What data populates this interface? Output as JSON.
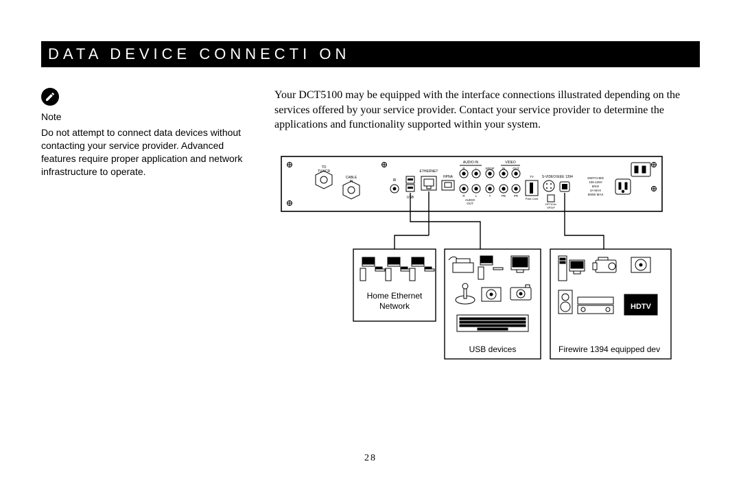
{
  "title": "DATA DEVICE CONNECTI   ON",
  "note": {
    "heading": "Note",
    "body": "Do not attempt to connect data devices without contacting your service provider. Advanced features require proper application and network infrastructure to operate."
  },
  "intro": "Your DCT5100 may be equipped with the interface connections illustrated depending on the services offered by your service provider. Contact your service provider to determine the applications and functionality supported within your system.",
  "panel": {
    "labels": {
      "to_tvvcr": "TO\nTV/VCR",
      "cable_in": "CABLE\nIN",
      "ir": "IR",
      "usb": "USB",
      "ethernet": "ETHERNET",
      "hpna": "HPNA",
      "audio_in": "AUDIO IN",
      "video": "VIDEO",
      "r": "R",
      "l": "L",
      "spdif": "SPDIF",
      "in": "IN",
      "out": "OUT",
      "audio_out": "AUDIO\nOUT",
      "y": "Y",
      "pb": "PB",
      "pr": "PR",
      "tv_passcard": "TV\nPass Card",
      "svideo": "S-VIDEO",
      "ieee1394": "IEEE 1394",
      "optical_spdif": "OPTICAL\nSPDIF",
      "switched_spec": "SWITCHED\n105-125V\n60Hz\n4A MAX\n500W MAX",
      "convenience_outlet": "CONVENIENCE\nOUTLET"
    }
  },
  "callouts": {
    "ethernet": {
      "line1": "Home Ethernet",
      "line2": "Network"
    },
    "usb": "USB devices",
    "firewire": "Firewire  1394 equipped dev",
    "hdtv_badge": "HDTV"
  },
  "page_number": "28"
}
